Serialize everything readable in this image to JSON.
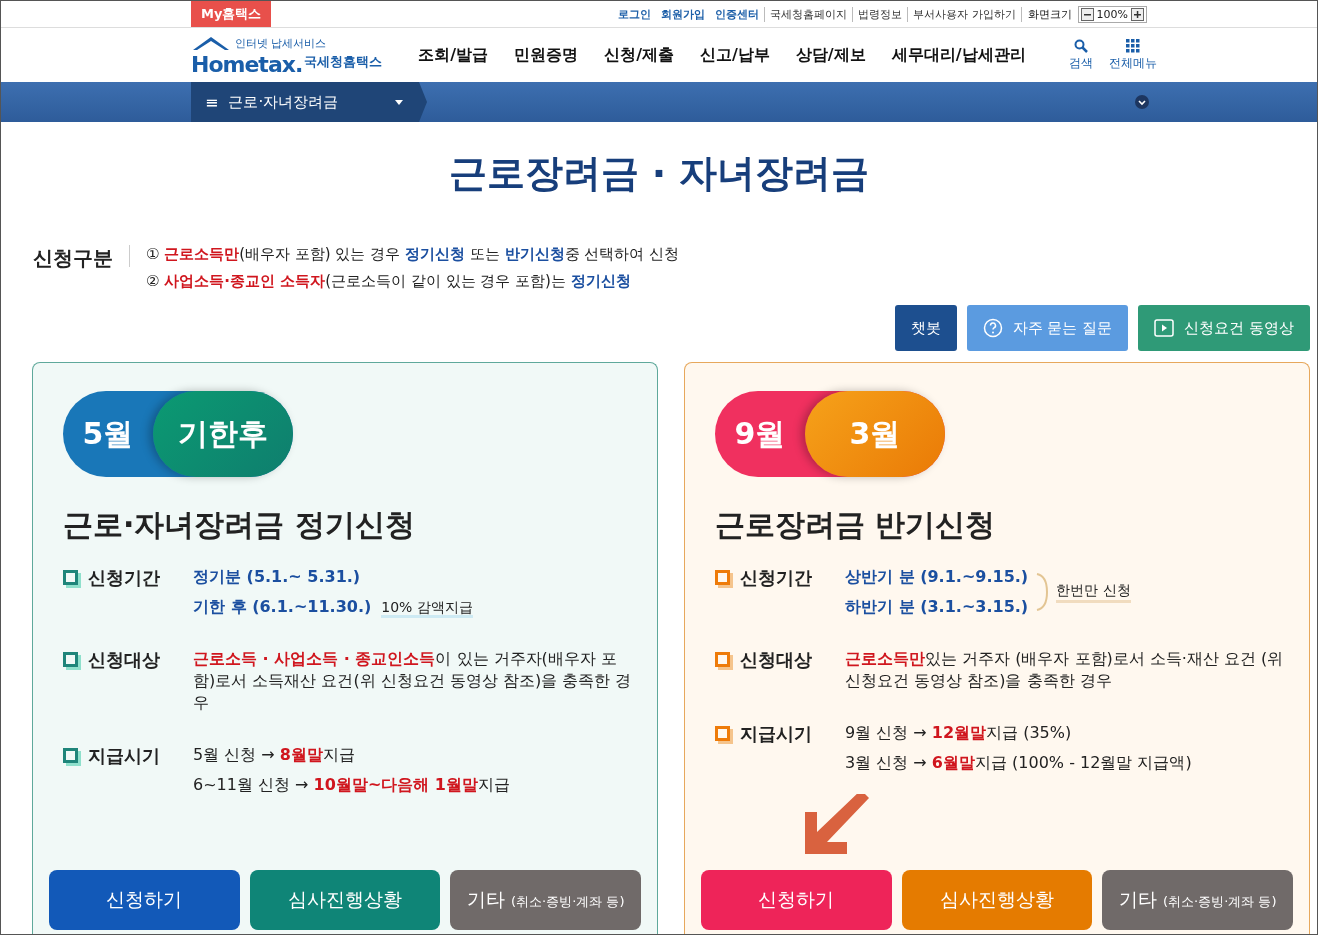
{
  "top_bar": {
    "my_tab": "My홈택스",
    "links": [
      {
        "label": "로그인",
        "emphasis": true
      },
      {
        "label": "회원가입",
        "emphasis": true
      },
      {
        "label": "인증센터",
        "emphasis": true
      },
      {
        "label": "국세청홈페이지",
        "emphasis": false
      },
      {
        "label": "법령정보",
        "emphasis": false
      },
      {
        "label": "부서사용자 가입하기",
        "emphasis": false
      }
    ],
    "zoom": {
      "label": "화면크기",
      "value": "100%"
    }
  },
  "header": {
    "logo": {
      "tagline": "인터넷 납세서비스",
      "name": "Hometax.",
      "sub": "국세청홈택스"
    },
    "menu": [
      "조회/발급",
      "민원증명",
      "신청/제출",
      "신고/납부",
      "상담/제보",
      "세무대리/납세관리"
    ],
    "tools": [
      {
        "kind": "search",
        "label": "검색"
      },
      {
        "kind": "grid",
        "label": "전체메뉴"
      }
    ]
  },
  "breadcrumb": {
    "menu_icon": "≡",
    "label": "근로·자녀장려금"
  },
  "page_title": "근로장려금 · 자녀장려금",
  "intro": {
    "label": "신청구분",
    "lines": [
      [
        {
          "text": "① "
        },
        {
          "text": "근로소득만",
          "color": "#d0161e"
        },
        {
          "text": "(배우자 포함) 있는 경우 "
        },
        {
          "text": "정기신청",
          "color": "#1b4fa0"
        },
        {
          "text": " 또는 "
        },
        {
          "text": "반기신청",
          "color": "#1b4fa0"
        },
        {
          "text": "중 선택하여 신청"
        }
      ],
      [
        {
          "text": "② "
        },
        {
          "text": "사업소득·종교인 소득자",
          "color": "#d0161e"
        },
        {
          "text": "(근로소득이 같이 있는 경우 포함)는 "
        },
        {
          "text": "정기신청",
          "color": "#1b4fa0"
        }
      ]
    ]
  },
  "actions": [
    {
      "kind": "chatbot",
      "label": "챗봇"
    },
    {
      "kind": "faq",
      "label": "자주 묻는 질문"
    },
    {
      "kind": "video",
      "label": "신청요건 동영상"
    }
  ],
  "cards": [
    {
      "color": "#1f857a",
      "badge": {
        "from": "5월",
        "to": "기한후"
      },
      "title": "근로·자녀장려금 정기신청",
      "rows": [
        {
          "label": "신청기간",
          "lines": [
            {
              "segments": [
                {
                  "text": "정기분 (5.1.~ 5.31.)",
                  "color": "#1b4fa0"
                }
              ]
            },
            {
              "segments": [
                {
                  "text": "기한 후 (6.1.~11.30.)",
                  "color": "#1b4fa0"
                }
              ],
              "note": "10% 감액지급"
            }
          ]
        },
        {
          "label": "신청대상",
          "lines": [
            {
              "segments": [
                {
                  "text": "근로소득 · 사업소득 · 종교인소득",
                  "color": "#d0161e"
                },
                {
                  "text": "이 있는 거주자(배우자 포함)로서 소득재산 요건(위 신청요건 동영상 참조)을 충족한 경우"
                }
              ]
            }
          ]
        },
        {
          "label": "지급시기",
          "lines": [
            {
              "segments": [
                {
                  "text": "5월 신청 → "
                },
                {
                  "text": "8월말",
                  "color": "#d0161e"
                },
                {
                  "text": "지급"
                }
              ]
            },
            {
              "segments": [
                {
                  "text": "6~11월 신청 → "
                },
                {
                  "text": "10월말~다음해 1월말",
                  "color": "#d0161e"
                },
                {
                  "text": "지급"
                }
              ]
            }
          ]
        }
      ],
      "buttons": [
        {
          "kind": "apply",
          "label": "신청하기"
        },
        {
          "kind": "status",
          "label": "심사진행상황"
        },
        {
          "kind": "other",
          "label": "기타",
          "sub": "(취소·증빙·계좌 등)"
        }
      ]
    },
    {
      "color": "#ee7b09",
      "badge": {
        "from": "9월",
        "to": "3월"
      },
      "title": "근로장려금 반기신청",
      "rows": [
        {
          "label": "신청기간",
          "group_note": "한번만 신청",
          "lines": [
            {
              "segments": [
                {
                  "text": "상반기 분 (9.1.~9.15.)",
                  "color": "#1b4fa0"
                }
              ]
            },
            {
              "segments": [
                {
                  "text": "하반기 분 (3.1.~3.15.)",
                  "color": "#1b4fa0"
                }
              ]
            }
          ]
        },
        {
          "label": "신청대상",
          "lines": [
            {
              "segments": [
                {
                  "text": "근로소득만",
                  "color": "#d0161e"
                },
                {
                  "text": "있는 거주자 (배우자 포함)로서 소득·재산 요건 (위 신청요건 동영상 참조)을 충족한 경우"
                }
              ]
            }
          ]
        },
        {
          "label": "지급시기",
          "lines": [
            {
              "segments": [
                {
                  "text": "9월 신청 → "
                },
                {
                  "text": "12월말",
                  "color": "#d0161e"
                },
                {
                  "text": "지급 (35%)"
                }
              ]
            },
            {
              "segments": [
                {
                  "text": "3월 신청 → "
                },
                {
                  "text": "6월말",
                  "color": "#d0161e"
                },
                {
                  "text": "지급 (100% - 12월말 지급액)"
                }
              ]
            }
          ]
        }
      ],
      "buttons": [
        {
          "kind": "apply",
          "label": "신청하기"
        },
        {
          "kind": "status",
          "label": "심사진행상황"
        },
        {
          "kind": "other",
          "label": "기타",
          "sub": "(취소·증빙·계좌 등)"
        }
      ]
    }
  ]
}
